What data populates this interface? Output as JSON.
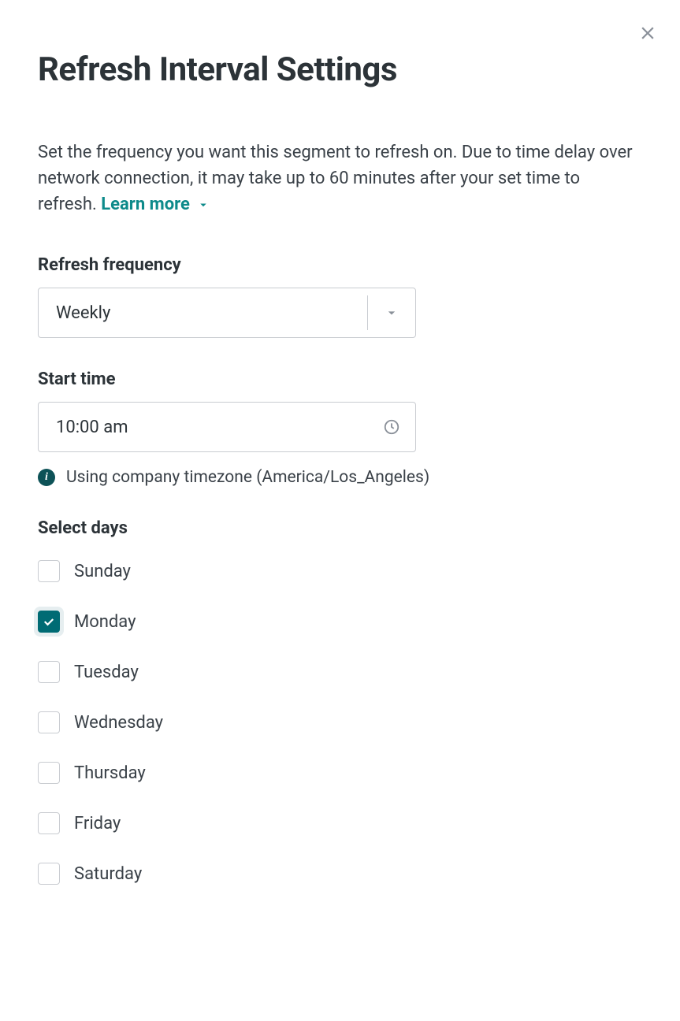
{
  "title": "Refresh Interval Settings",
  "description": "Set the frequency you want this segment to refresh on. Due to time delay over network connection, it may take up to 60 minutes after your set time to refresh.",
  "learn_more": "Learn more",
  "frequency": {
    "label": "Refresh frequency",
    "value": "Weekly"
  },
  "start_time": {
    "label": "Start time",
    "value": "10:00 am",
    "note": "Using company timezone (America/Los_Angeles)"
  },
  "select_days": {
    "label": "Select days",
    "days": [
      {
        "name": "Sunday",
        "checked": false
      },
      {
        "name": "Monday",
        "checked": true
      },
      {
        "name": "Tuesday",
        "checked": false
      },
      {
        "name": "Wednesday",
        "checked": false
      },
      {
        "name": "Thursday",
        "checked": false
      },
      {
        "name": "Friday",
        "checked": false
      },
      {
        "name": "Saturday",
        "checked": false
      }
    ]
  }
}
